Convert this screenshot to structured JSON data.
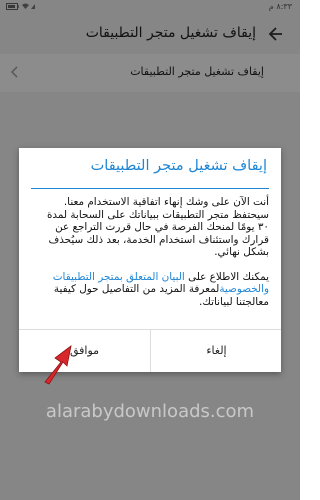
{
  "status_bar": {
    "time": "٨:٣٣ م",
    "icons": [
      "battery-icon",
      "wifi-icon",
      "signal-icon"
    ]
  },
  "app_bar": {
    "title": "إيقاف تشغيل متجر التطبيقات",
    "back_icon": "arrow-left-icon"
  },
  "settings_row": {
    "label": "إيقاف تشغيل متجر التطبيقات",
    "chevron_icon": "chevron-left-icon"
  },
  "dialog": {
    "title": "إيقاف تشغيل متجر التطبيقات",
    "paragraph1_line1": "أنت الآن على وشك إنهاء اتفاقية الاستخدام معنا.",
    "paragraph1_line2": "سيحتفظ متجر التطبيقات ببياناتك على السحابة لمدة",
    "paragraph1_line3": "٣٠ يومًا لمنحك الفرصة في حال قررت التراجع عن",
    "paragraph1_line4": "قرارك واستئناف استخدام الخدمة، بعد ذلك سيُحذف",
    "paragraph1_line5": "بشكل نهائي.",
    "paragraph2_prefix": "يمكنك الاطلاع على",
    "paragraph2_link1": "البيان المتعلق بمتجر التطبيقات",
    "paragraph2_link2": "والخصوصية",
    "paragraph2_rest": "لمعرفة المزيد من التفاصيل حول كيفية",
    "paragraph2_line3": "معالجتنا لبياناتك.",
    "cancel_label": "إلغاء",
    "ok_label": "موافق"
  },
  "annotation": {
    "arrow_color": "#d8282b"
  },
  "watermark": "alarabydownloads.com",
  "colors": {
    "accent": "#1f86d6",
    "background": "#f4f4f4"
  }
}
